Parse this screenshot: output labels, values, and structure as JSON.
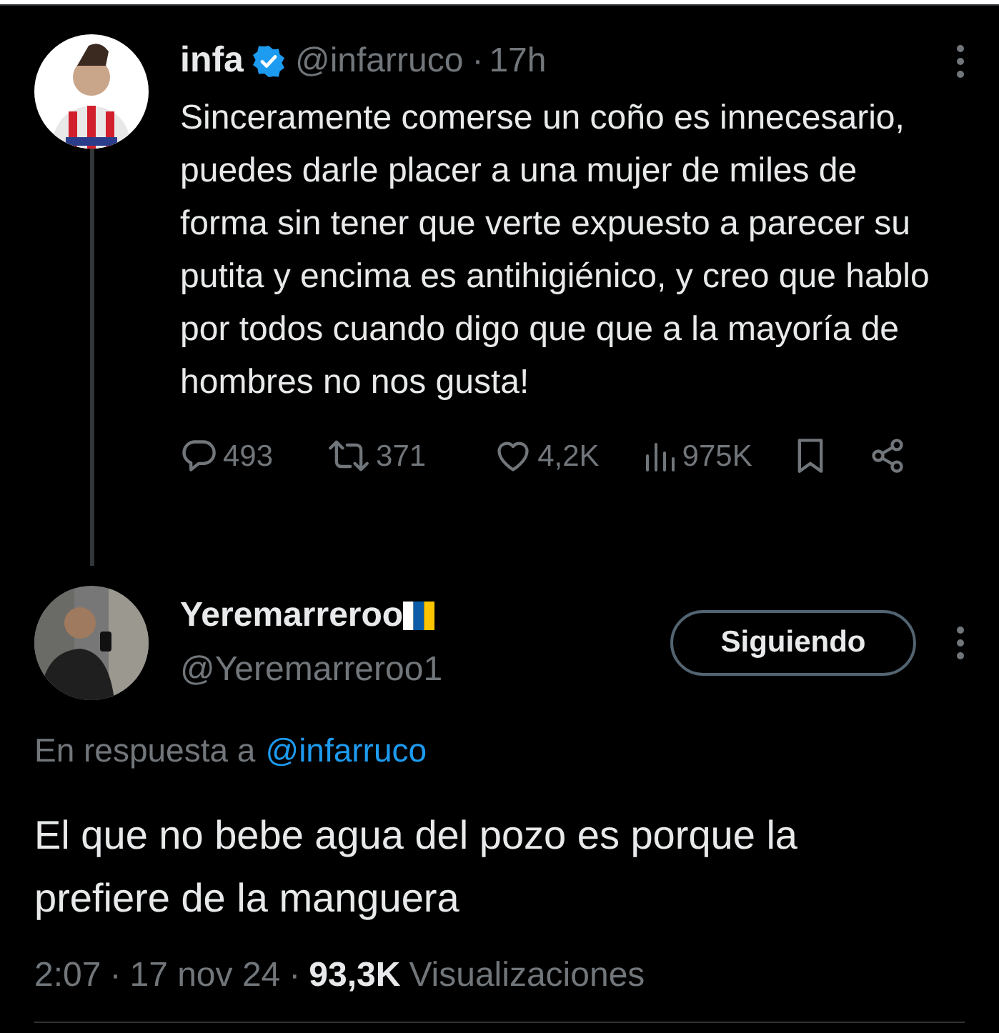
{
  "tweet": {
    "author": {
      "name": "infa",
      "verified": true,
      "handle": "@infarruco",
      "separator": "·",
      "time": "17h"
    },
    "text": "Sinceramente comerse un coño es innecesario, puedes darle placer a una mujer de miles de forma sin tener que verte expuesto a parecer su putita y encima es antihigiénico, y creo que hablo por todos cuando digo que que a la mayoría de hombres no nos gusta!",
    "actions": [
      {
        "kind": "reply",
        "count": "493"
      },
      {
        "kind": "retweet",
        "count": "371"
      },
      {
        "kind": "like",
        "count": "4,2K"
      },
      {
        "kind": "views",
        "count": "975K"
      },
      {
        "kind": "bookmark"
      },
      {
        "kind": "share"
      }
    ]
  },
  "reply": {
    "author": {
      "name": "Yeremarreroo",
      "flag": true,
      "handle": "@Yeremarreroo1"
    },
    "follow_button": "Siguiendo",
    "in_reply_prefix": "En respuesta a",
    "in_reply_handle": "@infarruco",
    "text": "El que no bebe agua del pozo es porque la prefiere de la manguera",
    "time": "2:07",
    "separator1": "·",
    "date": "17 nov 24",
    "separator2": "·",
    "views": "93,3K",
    "views_label": "Visualizaciones"
  }
}
